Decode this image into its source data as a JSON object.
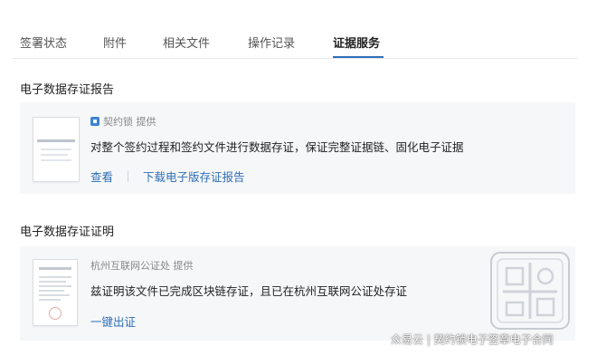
{
  "tabs": [
    {
      "label": "签署状态",
      "active": false
    },
    {
      "label": "附件",
      "active": false
    },
    {
      "label": "相关文件",
      "active": false
    },
    {
      "label": "操作记录",
      "active": false
    },
    {
      "label": "证据服务",
      "active": true
    }
  ],
  "accent_color": "#2f6fb6",
  "section_report": {
    "title": "电子数据存证报告",
    "provider": "契约锁 提供",
    "description": "对整个签约过程和签约文件进行数据存证，保证完整证据链、固化电子证据",
    "view_link": "查看",
    "download_link": "下载电子版存证报告"
  },
  "section_certificate": {
    "title": "电子数据存证证明",
    "provider": "杭州互联网公证处 提供",
    "description": "兹证明该文件已完成区块链存证，且已在杭州互联网公证处存证",
    "issue_link": "一键出证"
  },
  "watermark": "众易云 | 契约锁电子签章电子合同"
}
